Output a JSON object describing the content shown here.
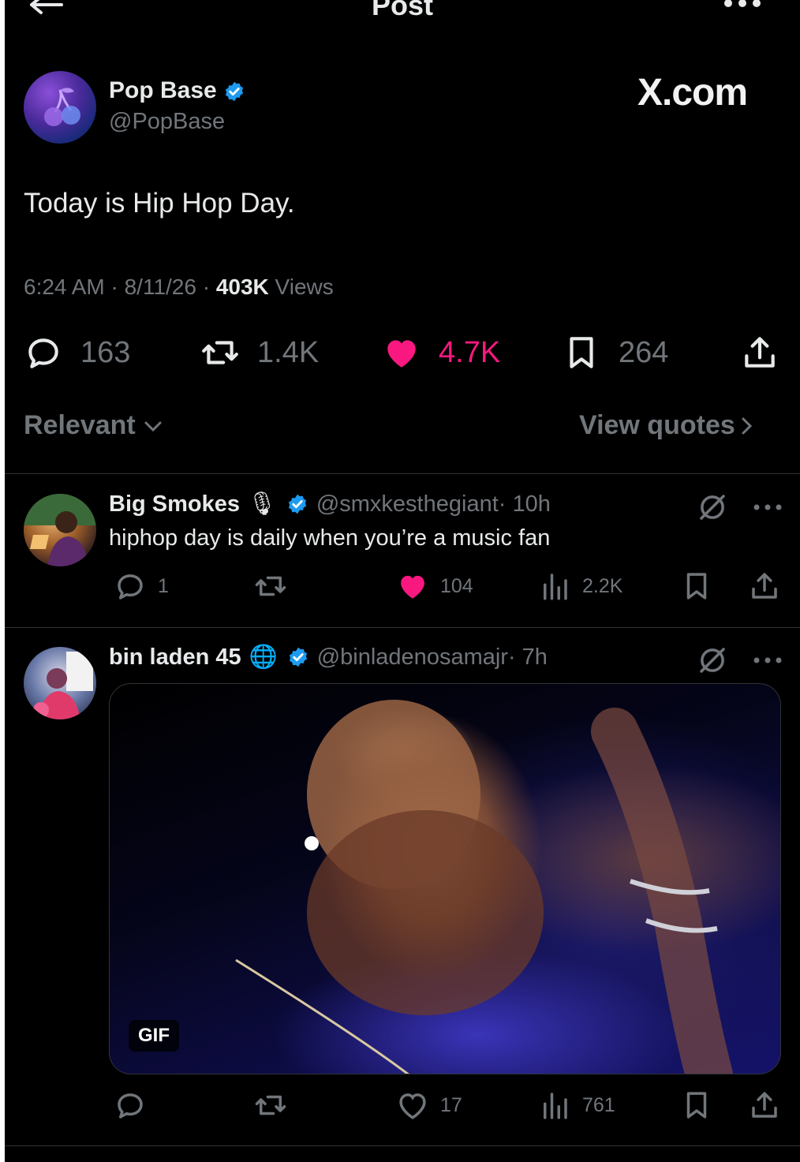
{
  "header": {
    "title": "Post"
  },
  "post": {
    "author_name": "Pop Base",
    "author_handle": "@PopBase",
    "watermark": "X.com",
    "text": "Today is Hip Hop Day.",
    "meta_time": "6:24 AM · 8/11/26 · ",
    "meta_views_count": "403K",
    "meta_views_label": " Views",
    "replies": "163",
    "reposts": "1.4K",
    "likes": "4.7K",
    "bookmarks": "264"
  },
  "sort": {
    "label": "Relevant",
    "quotes_label": "View quotes"
  },
  "replies": [
    {
      "name": "Big Smokes",
      "name_emoji": "🎙",
      "handle": "@smxkesthegiant",
      "time": " · 10h",
      "text": "hiphop day is daily when you’re a music fan",
      "replies": "1",
      "reposts": "",
      "likes": "104",
      "views": "2.2K"
    },
    {
      "name": "bin laden 45",
      "name_emoji": "🌐",
      "handle": "@binladenosamajr",
      "time": " · 7h",
      "media_badge": "GIF",
      "replies": "",
      "reposts": "",
      "likes": "17",
      "views": "761"
    }
  ],
  "colors": {
    "background": "#000000",
    "text": "#e7e9ea",
    "muted": "#71767b",
    "like": "#f91880",
    "verified": "#1d9bf0"
  }
}
